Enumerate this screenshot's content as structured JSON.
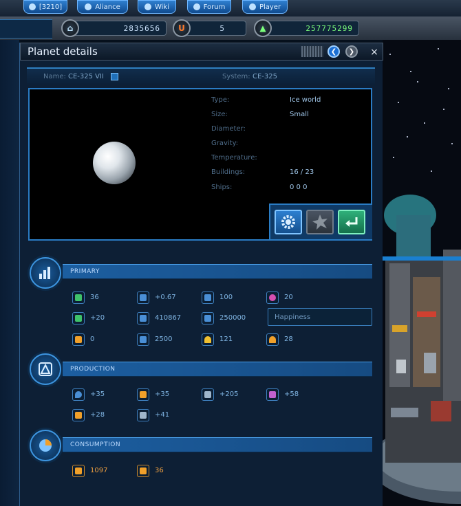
{
  "topnav": {
    "buttons": [
      {
        "label": "[3210]",
        "icon": "mail-icon"
      },
      {
        "label": "Aliance",
        "icon": "alliance-icon"
      },
      {
        "label": "Wiki",
        "icon": "wiki-icon"
      },
      {
        "label": "Forum",
        "icon": "forum-icon"
      },
      {
        "label": "Player",
        "icon": "player-icon"
      }
    ]
  },
  "resources": [
    {
      "icon": "population-icon",
      "value": "2835656"
    },
    {
      "icon": "uranium-icon",
      "value": "5"
    },
    {
      "icon": "credits-icon",
      "value": "257775299"
    }
  ],
  "panel": {
    "title": "Planet details",
    "close_label": "×"
  },
  "planet": {
    "name_label": "Name:",
    "name_value": "CE-325 VII",
    "system_label": "System:",
    "system_value": "CE-325",
    "properties": [
      {
        "key": "Type:",
        "value": "Ice world"
      },
      {
        "key": "Size:",
        "value": "Small"
      },
      {
        "key": "Diameter:",
        "value": ""
      },
      {
        "key": "Gravity:",
        "value": ""
      },
      {
        "key": "Temperature:",
        "value": ""
      },
      {
        "key": "Buildings:",
        "value": "16 / 23"
      },
      {
        "key": "Ships:",
        "value": "0 0 0"
      }
    ]
  },
  "sections": {
    "primary": {
      "label": "PRIMARY",
      "rows": [
        [
          {
            "icon": "population-icon",
            "value": "36",
            "color": "#3fc26a"
          },
          {
            "icon": "growth-icon",
            "value": "+0.67",
            "color": "#4a8fd6"
          },
          {
            "icon": "housing-icon",
            "value": "100",
            "color": "#4a8fd6"
          },
          {
            "icon": "happiness-icon",
            "value": "20",
            "color": "#d44fb0"
          }
        ],
        [
          {
            "icon": "flask-icon",
            "value": "+20",
            "color": "#3fc26a"
          },
          {
            "icon": "storage-icon",
            "value": "410867",
            "color": "#4a8fd6"
          },
          {
            "icon": "capacity-icon",
            "value": "250000",
            "color": "#4a8fd6"
          },
          {
            "icon": "hidden-icon",
            "value": "",
            "color": "#4a8fd6"
          }
        ],
        [
          {
            "icon": "ore-icon",
            "value": "0",
            "color": "#f0a02a"
          },
          {
            "icon": "energy-icon",
            "value": "2500",
            "color": "#4a8fd6"
          },
          {
            "icon": "dome-icon",
            "value": "121",
            "color": "#f0c030"
          },
          {
            "icon": "dome2-icon",
            "value": "28",
            "color": "#f0a02a"
          }
        ]
      ],
      "tooltip": "Happiness"
    },
    "production": {
      "label": "PRODUCTION",
      "rows": [
        [
          {
            "icon": "water-icon",
            "value": "+35",
            "color": "#4a8fd6"
          },
          {
            "icon": "food-icon",
            "value": "+35",
            "color": "#f0a02a"
          },
          {
            "icon": "metal-icon",
            "value": "+205",
            "color": "#9fb6cc"
          },
          {
            "icon": "crystal-icon",
            "value": "+58",
            "color": "#c060d0"
          }
        ],
        [
          {
            "icon": "fuel-icon",
            "value": "+28",
            "color": "#f0a02a"
          },
          {
            "icon": "industry-icon",
            "value": "+41",
            "color": "#9fb6cc"
          }
        ]
      ]
    },
    "consumption": {
      "label": "CONSUMPTION",
      "rows": [
        [
          {
            "icon": "energy-icon",
            "value": "1097",
            "color": "#f0a02a"
          },
          {
            "icon": "food-icon",
            "value": "36",
            "color": "#f0a02a"
          }
        ]
      ]
    }
  }
}
